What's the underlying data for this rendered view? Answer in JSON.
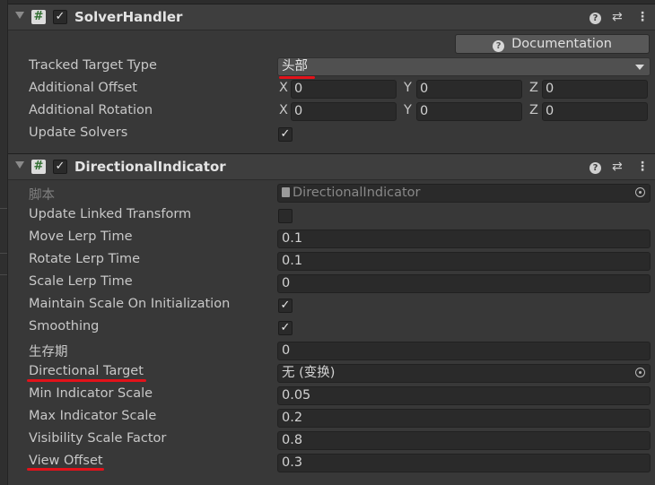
{
  "solver_handler": {
    "title": "SolverHandler",
    "enabled_check": "✓",
    "documentation_label": "Documentation",
    "tracked_target_type": {
      "label": "Tracked Target Type",
      "value": "头部"
    },
    "additional_offset": {
      "label": "Additional Offset",
      "x_label": "X",
      "x": "0",
      "y_label": "Y",
      "y": "0",
      "z_label": "Z",
      "z": "0"
    },
    "additional_rotation": {
      "label": "Additional Rotation",
      "x_label": "X",
      "x": "0",
      "y_label": "Y",
      "y": "0",
      "z_label": "Z",
      "z": "0"
    },
    "update_solvers": {
      "label": "Update Solvers",
      "checked": true,
      "mark": "✓"
    }
  },
  "directional_indicator": {
    "title": "DirectionalIndicator",
    "enabled_check": "✓",
    "script": {
      "label": "脚本",
      "value": "DirectionalIndicator"
    },
    "update_linked_transform": {
      "label": "Update Linked Transform",
      "checked": false,
      "mark": ""
    },
    "move_lerp_time": {
      "label": "Move Lerp Time",
      "value": "0.1"
    },
    "rotate_lerp_time": {
      "label": "Rotate Lerp Time",
      "value": "0.1"
    },
    "scale_lerp_time": {
      "label": "Scale Lerp Time",
      "value": "0"
    },
    "maintain_scale": {
      "label": "Maintain Scale On Initialization",
      "checked": true,
      "mark": "✓"
    },
    "smoothing": {
      "label": "Smoothing",
      "checked": true,
      "mark": "✓"
    },
    "lifetime": {
      "label": "生存期",
      "value": "0"
    },
    "directional_target": {
      "label": "Directional Target",
      "value": "无 (变换)"
    },
    "min_indicator_scale": {
      "label": "Min Indicator Scale",
      "value": "0.05"
    },
    "max_indicator_scale": {
      "label": "Max Indicator Scale",
      "value": "0.2"
    },
    "visibility_scale_factor": {
      "label": "Visibility Scale Factor",
      "value": "0.8"
    },
    "view_offset": {
      "label": "View Offset",
      "value": "0.3"
    }
  },
  "header_icons": {
    "help": "?",
    "presets": "⇄",
    "menu": "⋮"
  },
  "icons": [
    "foldout-arrow-icon",
    "script-icon",
    "help-icon",
    "presets-icon",
    "kebab-menu-icon",
    "object-picker-icon",
    "dropdown-arrow-icon"
  ],
  "colors": {
    "background": "#383838",
    "field": "#2a2a2a",
    "header": "#3e3e3e",
    "annotation": "#e3121a"
  }
}
